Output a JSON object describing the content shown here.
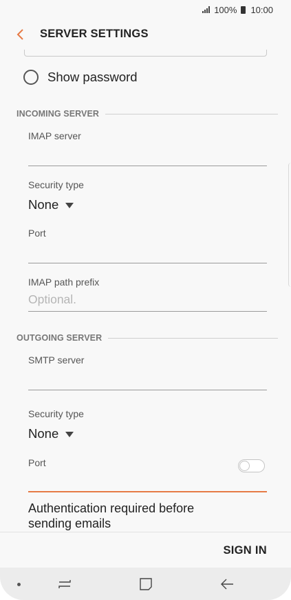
{
  "status_bar": {
    "battery": "100%",
    "time": "10:00"
  },
  "header": {
    "title": "SERVER SETTINGS",
    "back_icon": "chevron-left-icon",
    "accent_color": "#e67a45"
  },
  "show_password": {
    "label": "Show password",
    "checked": false
  },
  "incoming": {
    "section_title": "INCOMING SERVER",
    "imap_server_label": "IMAP server",
    "imap_server_value": "",
    "security_label": "Security type",
    "security_value": "None",
    "port_label": "Port",
    "port_value": "",
    "path_prefix_label": "IMAP path prefix",
    "path_prefix_placeholder": "Optional."
  },
  "outgoing": {
    "section_title": "OUTGOING SERVER",
    "smtp_server_label": "SMTP server",
    "smtp_server_value": "",
    "security_label": "Security type",
    "security_value": "None",
    "port_label": "Port",
    "port_value": "",
    "auth_label": "Authentication required before sending emails",
    "auth_enabled": false
  },
  "footer": {
    "sign_in_label": "SIGN IN"
  },
  "nav_bar": {
    "items": [
      "dot-icon",
      "recents-icon",
      "home-icon",
      "back-arrow-icon"
    ]
  }
}
